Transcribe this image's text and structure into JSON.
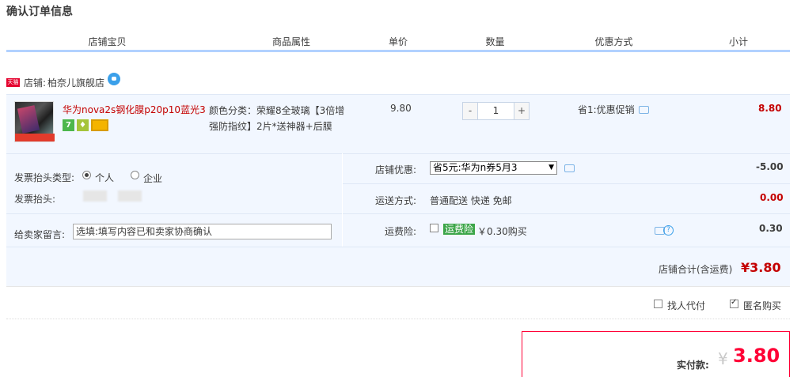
{
  "page_title": "确认订单信息",
  "columns": [
    "店铺宝贝",
    "商品属性",
    "单价",
    "数量",
    "优惠方式",
    "小计"
  ],
  "shop": {
    "badge": "天猫",
    "label": "店铺:",
    "name": "柏奈儿旗舰店"
  },
  "item": {
    "title": "华为nova2s钢化膜p20p10蓝光3...",
    "badges": [
      "7",
      "",
      ""
    ],
    "attributes": "颜色分类：荣耀8全玻璃【3倍增强防指纹】2片*送神器+后膜",
    "price": "9.80",
    "quantity": "1",
    "qty_minus": "-",
    "qty_plus": "+",
    "discount": "省1:优惠促销",
    "subtotal": "8.80"
  },
  "invoice": {
    "type_label": "发票抬头类型:",
    "type_options": [
      "个人",
      "企业"
    ],
    "selected_type": "个人",
    "head_label": "发票抬头:"
  },
  "note": {
    "label": "给卖家留言:",
    "placeholder": "选填:填写内容已和卖家协商确认"
  },
  "shop_discount": {
    "label": "店铺优惠:",
    "selected": "省5元:华为n券5月3",
    "value": "-5.00"
  },
  "shipping": {
    "label": "运送方式:",
    "method": "普通配送 快递 免邮",
    "value": "0.00"
  },
  "insurance": {
    "label": "运费险:",
    "tag": "运费险",
    "text": "￥0.30购买",
    "value": "0.30",
    "help": "?"
  },
  "shop_total": {
    "label": "店铺合计(含运费)",
    "value": "¥3.80"
  },
  "options": {
    "proxy_pay": "找人代付",
    "anonymous": "匿名购买"
  },
  "payment": {
    "label": "实付款:",
    "currency": "¥",
    "value": "3.80"
  },
  "colors": {
    "accent_red": "#c40000",
    "pay_red": "#ff0036",
    "panel_bg": "#f2f7ff",
    "header_line": "#b2d1ff",
    "insurance_green": "#3ba548"
  }
}
